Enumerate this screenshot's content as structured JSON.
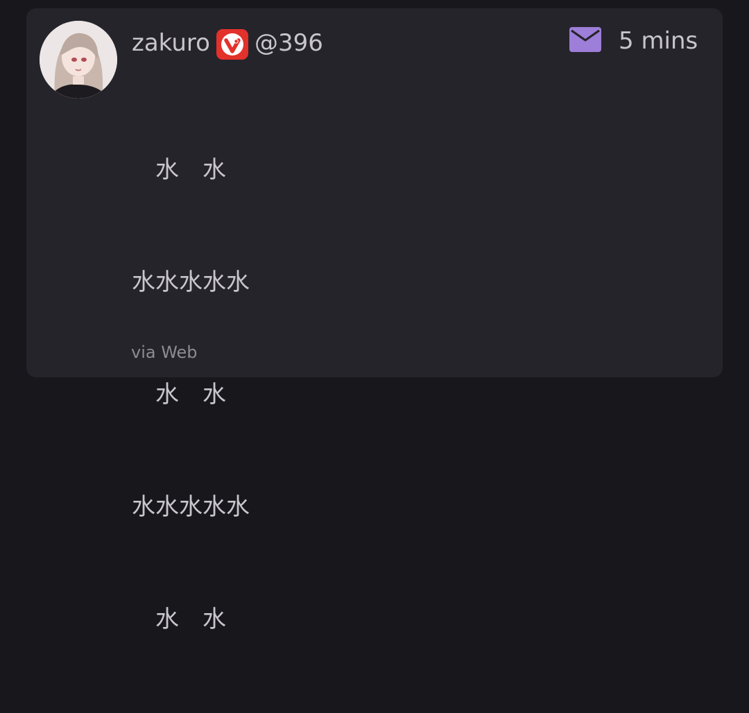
{
  "post": {
    "author": {
      "name": "zakuro",
      "handle": "@396",
      "badge_icon": "vivaldi-icon",
      "avatar_icon": "anime-girl-avatar"
    },
    "timestamp": "5 mins",
    "visibility_icon": "mail-icon",
    "body_lines": [
      "　水　水",
      "水水水水水",
      "　水　水",
      "水水水水水",
      "　水　水"
    ],
    "via": "via Web"
  },
  "colors": {
    "background": "#18181c",
    "card": "#25242a",
    "text": "#c8c6cc",
    "muted_text": "#8d8b93",
    "mail_icon": "#9d7ed8",
    "badge": "#e3312c"
  }
}
